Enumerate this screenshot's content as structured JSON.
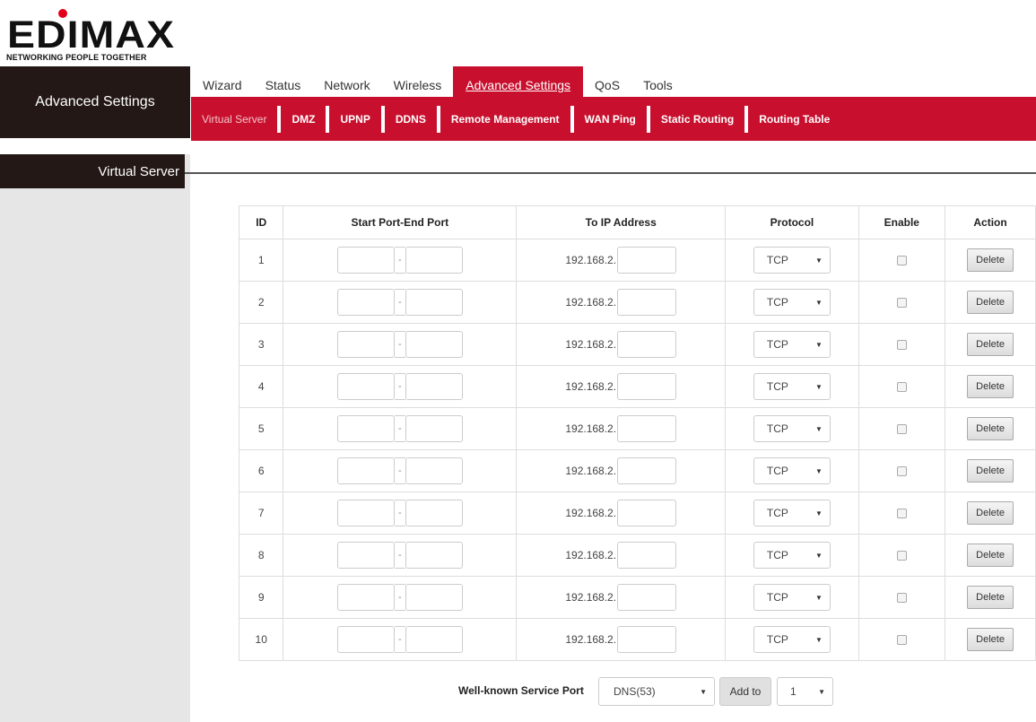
{
  "logo": {
    "wordmark": "EDIMAX",
    "tagline": "NETWORKING PEOPLE TOGETHER",
    "brand_red": "#e2001a"
  },
  "sidebar": {
    "header": "Advanced Settings",
    "items": [
      {
        "label": "Virtual Server",
        "active": true
      }
    ]
  },
  "topmenu": {
    "tabs": [
      {
        "label": "Wizard"
      },
      {
        "label": "Status"
      },
      {
        "label": "Network"
      },
      {
        "label": "Wireless"
      },
      {
        "label": "Advanced Settings",
        "active": true
      },
      {
        "label": "QoS"
      },
      {
        "label": "Tools"
      }
    ]
  },
  "submenu": {
    "accent": "#c8102e",
    "items": [
      {
        "label": "Virtual Server",
        "active": true
      },
      {
        "label": "DMZ"
      },
      {
        "label": "UPNP"
      },
      {
        "label": "DDNS"
      },
      {
        "label": "Remote Management"
      },
      {
        "label": "WAN Ping"
      },
      {
        "label": "Static Routing"
      },
      {
        "label": "Routing Table"
      }
    ]
  },
  "table": {
    "headers": {
      "id": "ID",
      "port": "Start Port-End Port",
      "ip": "To IP Address",
      "protocol": "Protocol",
      "enable": "Enable",
      "action": "Action"
    },
    "rows": [
      {
        "id": "1",
        "start_port": "",
        "dash": "-",
        "end_port": "",
        "ip_prefix": "192.168.2.",
        "ip_last": "",
        "protocol": "TCP",
        "enabled": false,
        "action": "Delete"
      },
      {
        "id": "2",
        "start_port": "",
        "dash": "-",
        "end_port": "",
        "ip_prefix": "192.168.2.",
        "ip_last": "",
        "protocol": "TCP",
        "enabled": false,
        "action": "Delete"
      },
      {
        "id": "3",
        "start_port": "",
        "dash": "-",
        "end_port": "",
        "ip_prefix": "192.168.2.",
        "ip_last": "",
        "protocol": "TCP",
        "enabled": false,
        "action": "Delete"
      },
      {
        "id": "4",
        "start_port": "",
        "dash": "-",
        "end_port": "",
        "ip_prefix": "192.168.2.",
        "ip_last": "",
        "protocol": "TCP",
        "enabled": false,
        "action": "Delete"
      },
      {
        "id": "5",
        "start_port": "",
        "dash": "-",
        "end_port": "",
        "ip_prefix": "192.168.2.",
        "ip_last": "",
        "protocol": "TCP",
        "enabled": false,
        "action": "Delete"
      },
      {
        "id": "6",
        "start_port": "",
        "dash": "-",
        "end_port": "",
        "ip_prefix": "192.168.2.",
        "ip_last": "",
        "protocol": "TCP",
        "enabled": false,
        "action": "Delete"
      },
      {
        "id": "7",
        "start_port": "",
        "dash": "-",
        "end_port": "",
        "ip_prefix": "192.168.2.",
        "ip_last": "",
        "protocol": "TCP",
        "enabled": false,
        "action": "Delete"
      },
      {
        "id": "8",
        "start_port": "",
        "dash": "-",
        "end_port": "",
        "ip_prefix": "192.168.2.",
        "ip_last": "",
        "protocol": "TCP",
        "enabled": false,
        "action": "Delete"
      },
      {
        "id": "9",
        "start_port": "",
        "dash": "-",
        "end_port": "",
        "ip_prefix": "192.168.2.",
        "ip_last": "",
        "protocol": "TCP",
        "enabled": false,
        "action": "Delete"
      },
      {
        "id": "10",
        "start_port": "",
        "dash": "-",
        "end_port": "",
        "ip_prefix": "192.168.2.",
        "ip_last": "",
        "protocol": "TCP",
        "enabled": false,
        "action": "Delete"
      }
    ]
  },
  "footer": {
    "service_label": "Well-known Service Port",
    "service_value": "DNS(53)",
    "add_label": "Add to",
    "target_value": "1"
  }
}
